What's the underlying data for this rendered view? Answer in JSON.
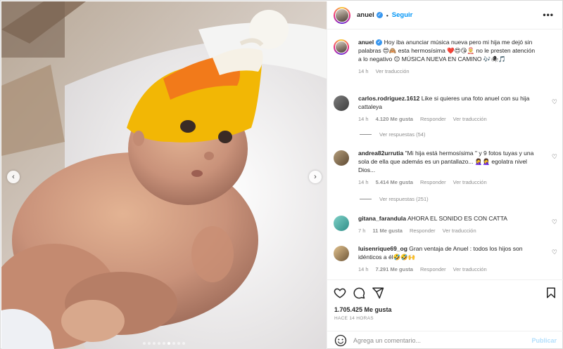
{
  "post": {
    "username": "anuel",
    "separator": "•",
    "follow_label": "Seguir",
    "more_glyph": "•••"
  },
  "caption": {
    "username": "anuel",
    "text": "Hoy iba anunciar música nueva pero mi hija me dejó sin palabras 😍🙈 esta hermosísima ❤️😍😘🤶 no le presten atención a lo negativo 😊 MÚSICA NUEVA EN CAMINO 🎶🕷🎵",
    "time": "14 h",
    "translate": "Ver traducción"
  },
  "comments": [
    {
      "username": "carlos.rodriguez.1612",
      "text": "Like si quieres una foto anuel con su hija cattaleya",
      "time": "14 h",
      "likes": "4.120 Me gusta",
      "reply": "Responder",
      "translate": "Ver traducción",
      "replies": "Ver respuestas (54)"
    },
    {
      "username": "andrea82urrutia",
      "text": "\"Mi hija está hermosísima \" y 9 fotos tuyas y una sola de ella que además es un pantallazo... 🤦‍♀️🤦‍♀️ egolatra nivel Dios...",
      "time": "14 h",
      "likes": "5.414 Me gusta",
      "reply": "Responder",
      "translate": "Ver traducción",
      "replies": "Ver respuestas (251)"
    },
    {
      "username": "gitana_farandula",
      "text": "AHORA EL SONIDO ES CON CATTA",
      "time": "7 h",
      "likes": "11 Me gusta",
      "reply": "Responder",
      "translate": "Ver traducción"
    },
    {
      "username": "luisenrique69_og",
      "text": "Gran ventaja de Anuel : todos los hijos son idénticos a él🤣🤣🙌",
      "time": "14 h",
      "likes": "7.291 Me gusta",
      "reply": "Responder",
      "translate": "Ver traducción"
    }
  ],
  "actions": {
    "likes": "1.705.425 Me gusta",
    "time_ago": "HACE 14 HORAS",
    "icons": [
      "heart-icon",
      "comment-icon",
      "share-icon",
      "bookmark-icon"
    ]
  },
  "composer": {
    "placeholder": "Agrega un comentario...",
    "publish_label": "Publicar"
  },
  "carousel": {
    "dot_count": 9,
    "active_index": 5,
    "prev_glyph": "‹",
    "next_glyph": "›"
  },
  "colors": {
    "link_blue": "#0095f6",
    "verified_blue": "#3897f0",
    "publish_disabled": "#b2dffc",
    "hat_yellow": "#f2b705",
    "hat_orange": "#f27a1a"
  }
}
